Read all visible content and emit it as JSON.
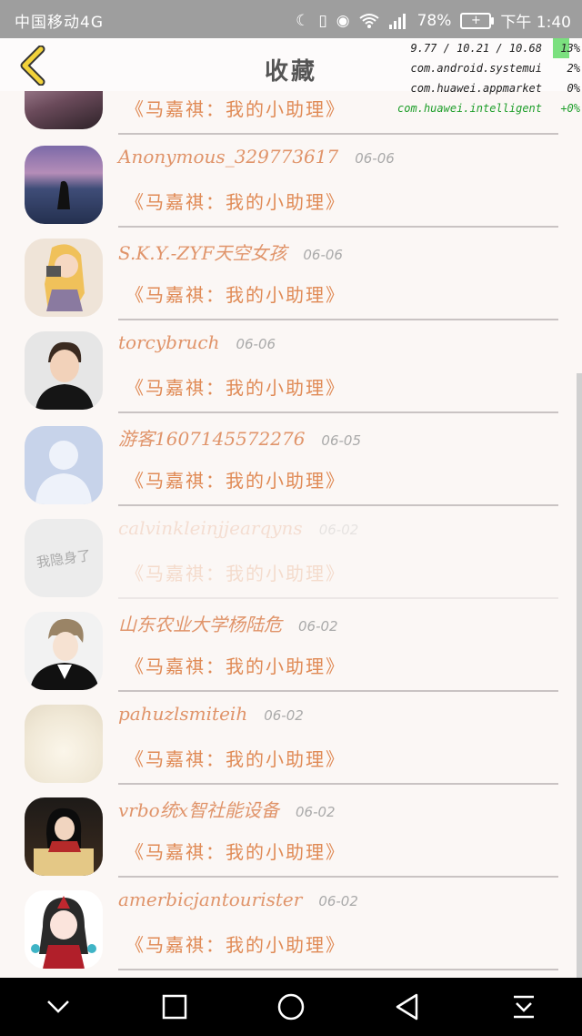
{
  "status_bar": {
    "carrier": "中国移动4G",
    "battery": "78%",
    "time": "下午 1:40",
    "icons": [
      "moon-icon",
      "vibrate-icon",
      "eye-icon",
      "wifi-icon",
      "signal-icon",
      "battery-icon"
    ]
  },
  "header": {
    "title": "收藏",
    "back_icon": "chevron-left-icon"
  },
  "debug_overlay": {
    "load": "9.77 / 10.21 / 10.68",
    "cpu": "13%",
    "procs": [
      {
        "name": "com.android.systemui",
        "value": "2%"
      },
      {
        "name": "com.huawei.appmarket",
        "value": "0%"
      },
      {
        "name": "com.huawei.intelligent",
        "value": "+0%"
      }
    ]
  },
  "favorites": {
    "partial_first_label": "《马嘉祺：我的小助理》",
    "items": [
      {
        "name": "Anonymous_329773617",
        "date": "06-06",
        "label": "《马嘉祺：我的小助理》",
        "avatar": "sunset-avatar"
      },
      {
        "name": "S.K.Y.-ZYF天空女孩",
        "date": "06-06",
        "label": "《马嘉祺：我的小助理》",
        "avatar": "anime-girl-camera-avatar"
      },
      {
        "name": "torcybruch",
        "date": "06-06",
        "label": "《马嘉祺：我的小助理》",
        "avatar": "boy-avatar"
      },
      {
        "name": "游客1607145572276",
        "date": "06-05",
        "label": "《马嘉祺：我的小助理》",
        "avatar": "default-user-avatar"
      },
      {
        "name": "calvinkleinjjearqyns",
        "date": "06-02",
        "label": "《马嘉祺：我的小助理》",
        "avatar": "hidden-avatar",
        "avatar_text": "我隐身了"
      },
      {
        "name": "山东农业大学杨陆危",
        "date": "06-02",
        "label": "《马嘉祺：我的小助理》",
        "avatar": "anime-man-avatar"
      },
      {
        "name": "pahuzlsmiteih",
        "date": "06-02",
        "label": "《马嘉祺：我的小助理》",
        "avatar": "white-cloth-avatar"
      },
      {
        "name": "vrbo统x智社能设备",
        "date": "06-02",
        "label": "《马嘉祺：我的小助理》",
        "avatar": "girl-reading-avatar"
      },
      {
        "name": "amerbicjantourister",
        "date": "06-02",
        "label": "《马嘉祺：我的小助理》",
        "avatar": "chibi-avatar"
      }
    ]
  },
  "nav_bar": [
    "chevron-down-icon",
    "square-icon",
    "circle-icon",
    "triangle-back-icon",
    "pull-down-icon"
  ]
}
